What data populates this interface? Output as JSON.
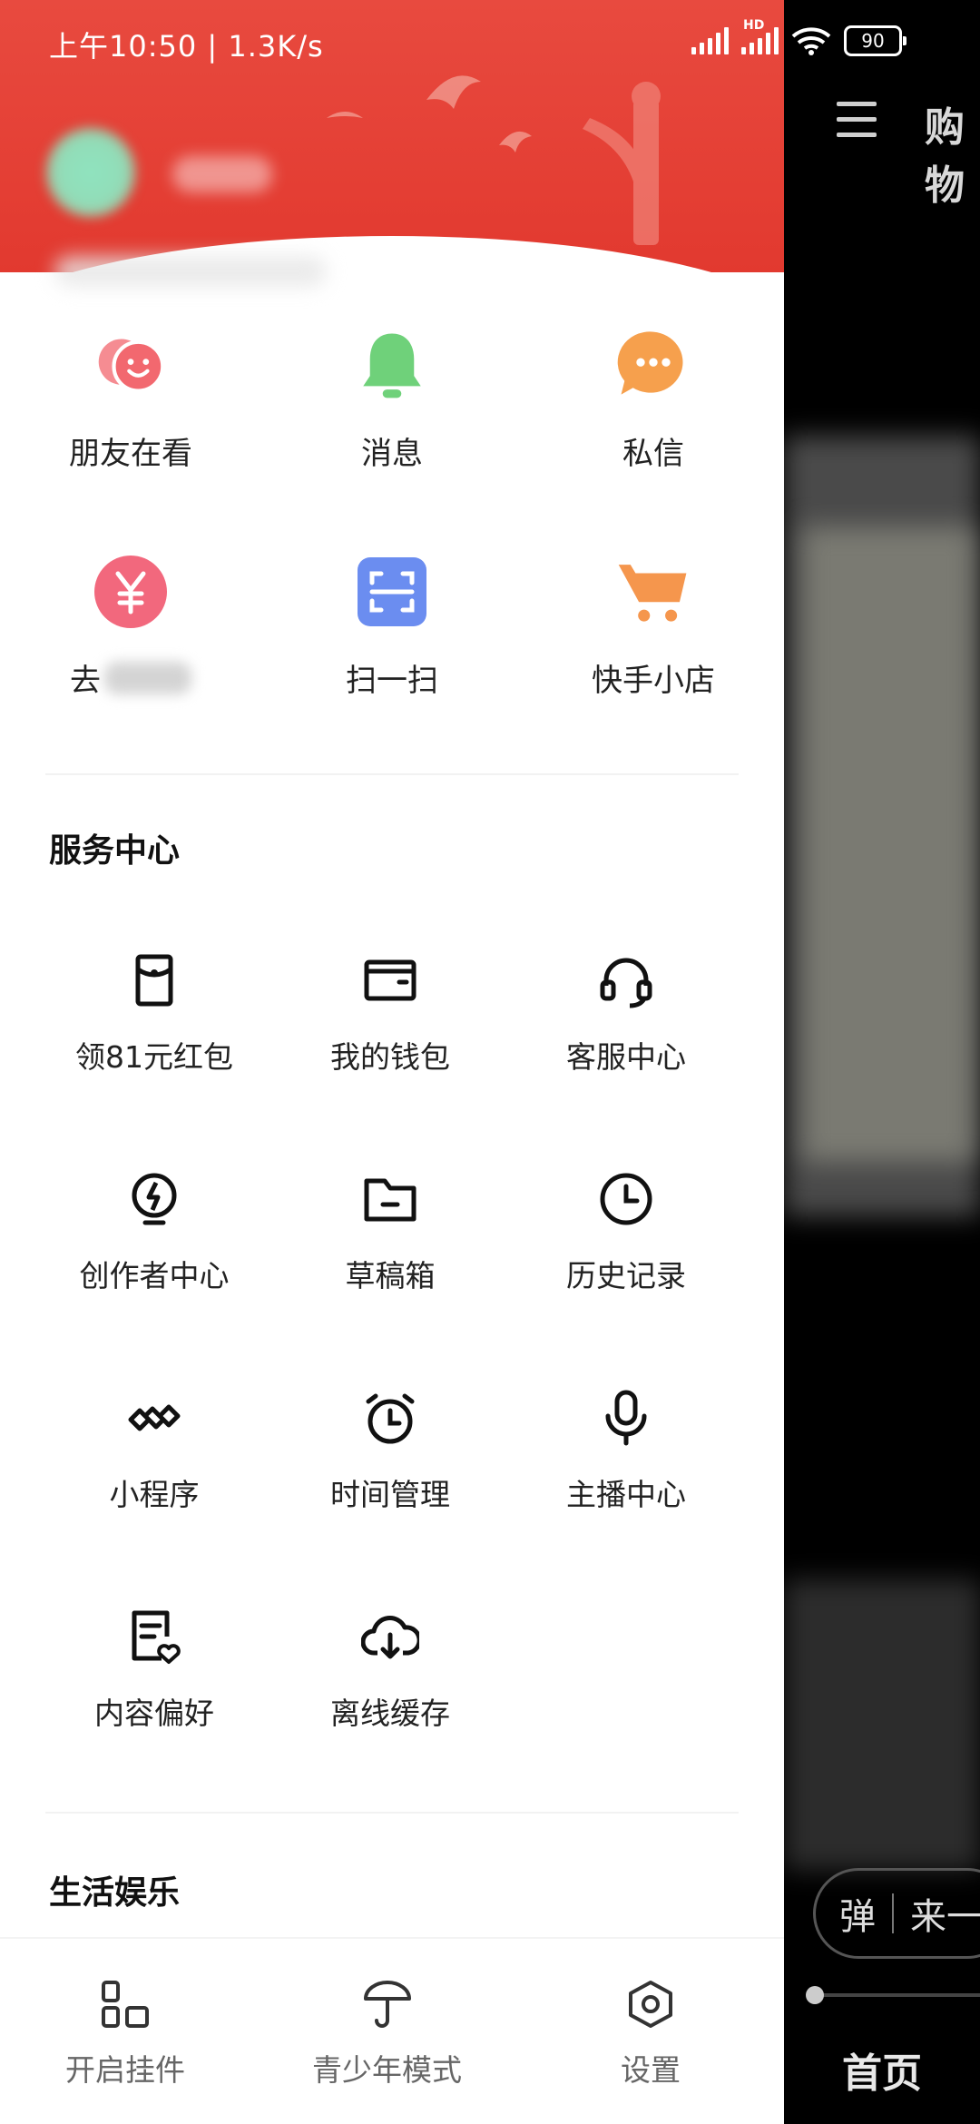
{
  "status": {
    "time": "上午10:50 | 1.3K/s",
    "hd": "HD",
    "battery": "90"
  },
  "quick_items": [
    {
      "label": "朋友在看",
      "icon": "friends-watching-icon",
      "color": "#f2686f"
    },
    {
      "label": "消息",
      "icon": "bell-icon",
      "color": "#6fd17a"
    },
    {
      "label": "私信",
      "icon": "chat-bubble-icon",
      "color": "#f6a04d"
    },
    {
      "label": "去",
      "icon": "yuan-coin-icon",
      "color": "#f2687d"
    },
    {
      "label": "扫一扫",
      "icon": "scan-icon",
      "color": "#6b8df0"
    },
    {
      "label": "快手小店",
      "icon": "cart-icon",
      "color": "#f5964d"
    }
  ],
  "service_center": {
    "title": "服务中心",
    "items": [
      {
        "label": "领81元红包",
        "icon": "red-packet-icon"
      },
      {
        "label": "我的钱包",
        "icon": "wallet-icon"
      },
      {
        "label": "客服中心",
        "icon": "headset-icon"
      },
      {
        "label": "创作者中心",
        "icon": "bulb-bolt-icon"
      },
      {
        "label": "草稿箱",
        "icon": "folder-icon"
      },
      {
        "label": "历史记录",
        "icon": "clock-icon"
      },
      {
        "label": "小程序",
        "icon": "infinity-link-icon"
      },
      {
        "label": "时间管理",
        "icon": "alarm-clock-icon"
      },
      {
        "label": "主播中心",
        "icon": "microphone-icon"
      },
      {
        "label": "内容偏好",
        "icon": "doc-heart-icon"
      },
      {
        "label": "离线缓存",
        "icon": "cloud-download-icon"
      }
    ]
  },
  "life_entertainment": {
    "title": "生活娱乐"
  },
  "bottom_bar": {
    "widget": "开启挂件",
    "youth_mode": "青少年模式",
    "settings": "设置"
  },
  "right_panel": {
    "top_tab": "购物",
    "danmu_label": "弹",
    "danmu_hint": "来一",
    "home_tab": "首页"
  },
  "colors": {
    "header_red": "#e2392f",
    "text_main": "#222222",
    "text_secondary": "#666666"
  }
}
